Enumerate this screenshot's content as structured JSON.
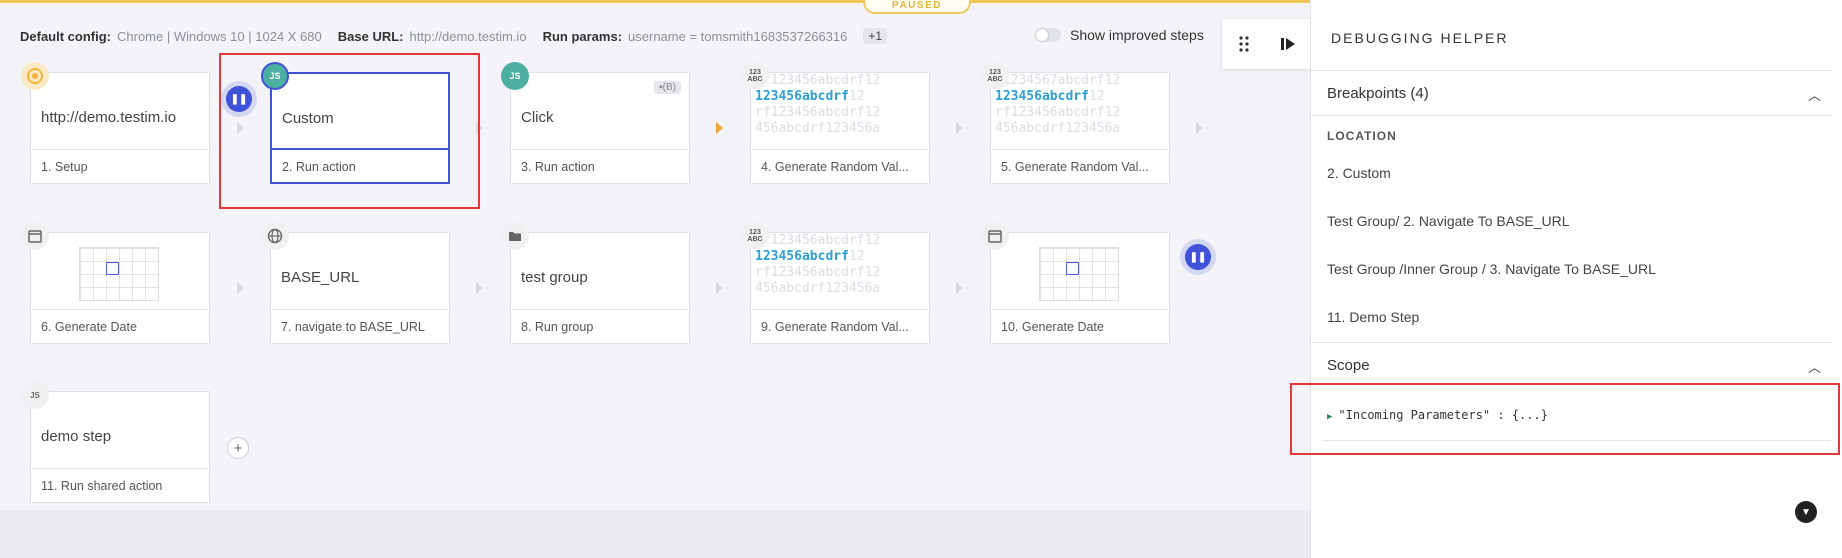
{
  "status": {
    "paused_label": "PAUSED"
  },
  "config": {
    "default_config_key": "Default config:",
    "default_config_value": "Chrome | Windows 10 | 1024 X 680",
    "base_url_key": "Base URL:",
    "base_url_value": "http://demo.testim.io",
    "run_params_key": "Run params:",
    "run_params_value": "username = tomsmith1683537266316",
    "run_params_more": "+1"
  },
  "toolbar": {
    "show_improved_label": "Show improved steps"
  },
  "steps": [
    {
      "title": "http://demo.testim.io",
      "footer": "1. Setup",
      "icon": "chrome-icon"
    },
    {
      "title": "Custom",
      "footer": "2. Run action",
      "icon": "js-icon"
    },
    {
      "title": "Click",
      "footer": "3. Run action",
      "icon": "js-icon",
      "tag": "(B)"
    },
    {
      "title": "",
      "footer": "4. Generate Random Val...",
      "icon": "123-abc-icon",
      "random_text": "123456abcdrf"
    },
    {
      "title": "",
      "footer": "5. Generate Random Val...",
      "icon": "123-abc-icon",
      "random_text": "123456abcdrf"
    },
    {
      "title": "",
      "footer": "6. Generate Date",
      "icon": "calendar-icon"
    },
    {
      "title": "BASE_URL",
      "footer": "7. navigate to BASE_URL",
      "icon": "globe-icon"
    },
    {
      "title": "test group",
      "footer": "8. Run group",
      "icon": "folder-icon"
    },
    {
      "title": "",
      "footer": "9. Generate Random Val...",
      "icon": "123-abc-icon",
      "random_text": "123456abcdrf"
    },
    {
      "title": "",
      "footer": "10. Generate Date",
      "icon": "calendar-icon"
    },
    {
      "title": "demo step",
      "footer": "11. Run shared action",
      "icon": "js-icon"
    }
  ],
  "icons": {
    "rnd_badge": "123 ABC",
    "js_badge": "JS"
  },
  "panel": {
    "header": "DEBUGGING HELPER",
    "breakpoints_label": "Breakpoints (4)",
    "location_header": "LOCATION",
    "breakpoints": [
      "2. Custom",
      "Test Group/ 2. Navigate To BASE_URL",
      "Test Group /Inner Group / 3. Navigate To BASE_URL",
      "11. Demo Step"
    ],
    "scope_label": "Scope",
    "scope_key": "\"Incoming Parameters\"",
    "scope_value": ": {...}"
  },
  "colors": {
    "accent": "#3f52d8",
    "highlight": "#e0383b",
    "paused": "#f0c85a"
  }
}
